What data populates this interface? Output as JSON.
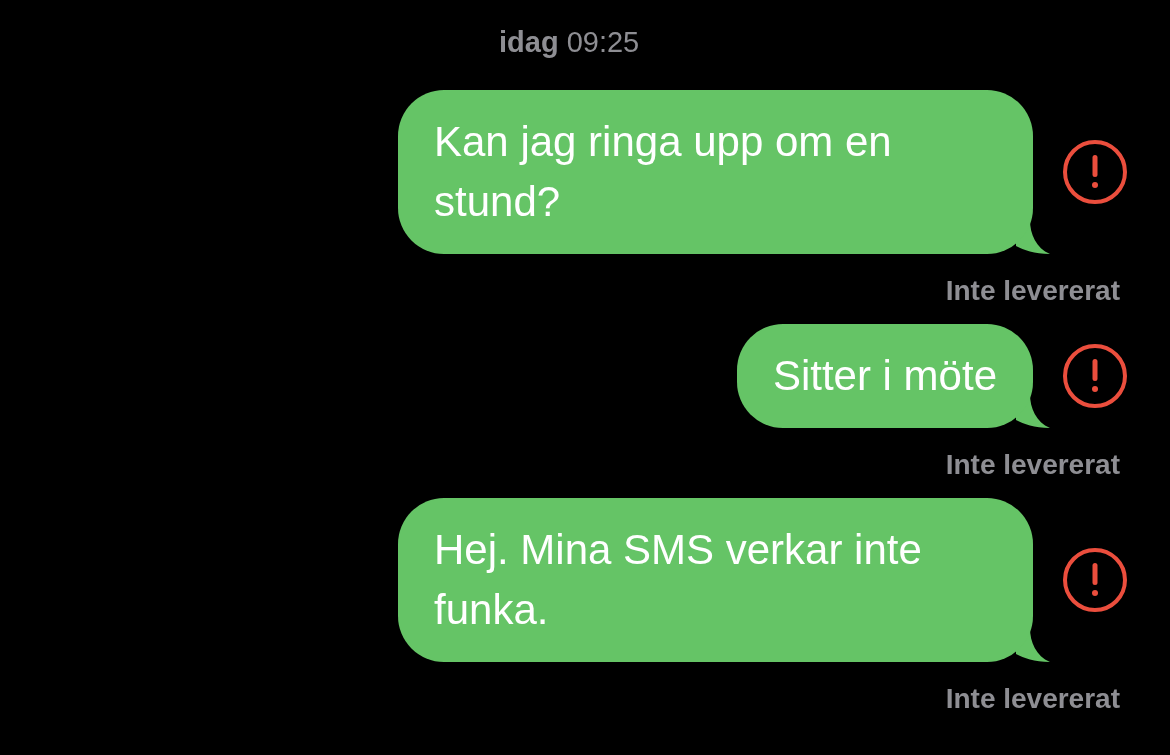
{
  "timestamp": "**idag** 09:25",
  "messages": [
    {
      "text": "Kan jag ringa upp om en stund?",
      "failed": true,
      "status": "Inte levererat"
    },
    {
      "text": "Sitter i möte",
      "failed": true,
      "status": "Inte levererat"
    },
    {
      "text": "Hej. Mina SMS verkar inte funka.",
      "failed": true,
      "status": "Inte levererat"
    }
  ]
}
